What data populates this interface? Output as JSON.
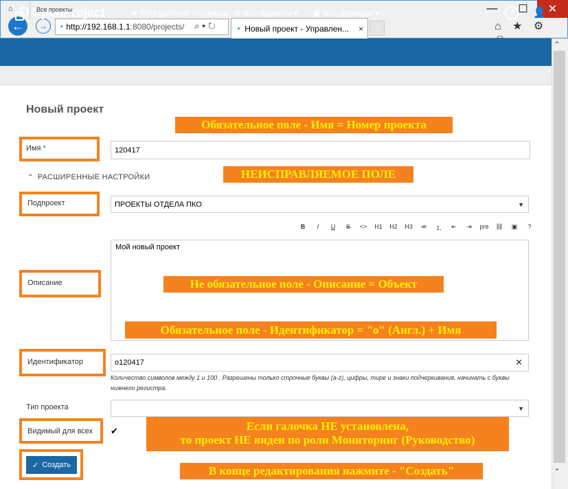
{
  "browser": {
    "address_host": "http://192.168.1.1",
    "address_rest": ":8080/projects/",
    "address_icons": "⌕ ▾ ↻",
    "tab_title": "Новый проект - Управлен...",
    "tab_close": "×",
    "win_min": "—",
    "win_max": "☐",
    "win_close": "✕",
    "right_icons": "⌂ ★ ⚙ ☺"
  },
  "header": {
    "logo": "OpenProject",
    "menu": [
      {
        "icon": "★",
        "label": "Моя рабочая страница"
      },
      {
        "icon": "≋",
        "label": "Все проекты ▾"
      },
      {
        "icon": "▣",
        "label": "Все функции ▾"
      }
    ],
    "search_icon": "⌕",
    "help_icon": "?",
    "user_icon": "👤"
  },
  "breadcrumb": {
    "home_icon": "⌂",
    "label": "Все проекты"
  },
  "form": {
    "title": "Новый проект",
    "name_label": "Имя",
    "name_required": "*",
    "name_value": "120417",
    "advanced_label": "РАСШИРЕННЫЕ НАСТРОЙКИ",
    "advanced_chevron": "⌃",
    "subproject_label": "Подпроект",
    "subproject_value": "ПРОЕКТЫ ОТДЕЛА ПКО",
    "toolbar": [
      "B",
      "I",
      "U",
      "S",
      "<>",
      "H1",
      "H2",
      "H3",
      "≔",
      "⒈",
      "⇤",
      "⇥",
      "pre",
      "⛓",
      "▣",
      "?"
    ],
    "description_label": "Описание",
    "description_value": "Мой новый проект",
    "identifier_label": "Идентификатор",
    "identifier_value": "o120417",
    "identifier_clear": "✕",
    "identifier_hint": "Количество символов между 1 и 100 . Разрешены только строчные буквы (a-z), цифры, тире и знаки подчеркивания, начинать с буквы нижнего регистра.",
    "project_type_label": "Тип проекта",
    "project_type_value": "",
    "public_label": "Видимый для всех",
    "public_checked": "✔",
    "create_button": "Создать",
    "create_icon": "✓",
    "dropdown_arrow": "▼"
  },
  "annotations": {
    "name_note": "Обязательное поле - Имя = Номер проекта",
    "subproject_note": "НЕИСПРАВЛЯЕМОЕ ПОЛЕ",
    "description_note": "Не обязательное поле - Описание = Объект",
    "identifier_note": "Обязательное поле - Идентификатор = \"о\" (Англ.) + Имя",
    "public_note_line1": "Если галочка НЕ установлена,",
    "public_note_line2": "то проект НЕ виден по роли Мониторинг (Руководство)",
    "create_note": "В конце редактирования нажмите - \"Создать\""
  },
  "colors": {
    "brand": "#1a67a3",
    "annotation_bg": "#f5821f",
    "annotation_text": "#ffef00"
  }
}
